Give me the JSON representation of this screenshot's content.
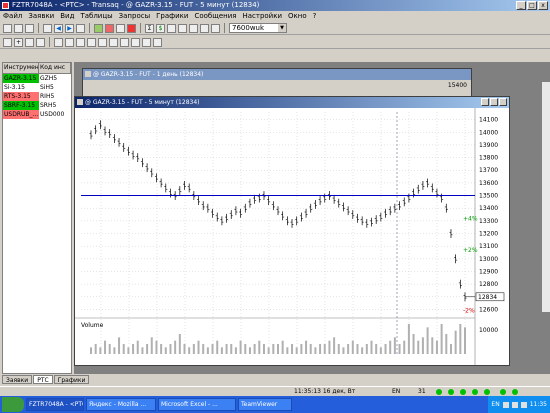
{
  "app": {
    "title": "FZTR7048A - <РТС> - Transaq - @ GAZR-3.15 - FUT - 5 минут (12834)",
    "minimize": "_",
    "maximize": "□",
    "close": "x"
  },
  "menu": [
    "Файл",
    "Заявки",
    "Вид",
    "Таблицы",
    "Запросы",
    "Графики",
    "Сообщения",
    "Настройки",
    "Окно",
    "?"
  ],
  "toolbar": {
    "combo_value": "7600wuk"
  },
  "left_panel": {
    "headers": [
      "Инструмент",
      "Код инс"
    ],
    "rows": [
      {
        "name": "GAZR-3.15",
        "code": "GZH5",
        "bg": "#00c000"
      },
      {
        "name": "Si-3.15",
        "code": "SiH5",
        "bg": "#ffffff"
      },
      {
        "name": "RTS-3.15",
        "code": "RIH5",
        "bg": "#ff7070"
      },
      {
        "name": "SBRF-3.15",
        "code": "SRH5",
        "bg": "#00c000"
      },
      {
        "name": "USDRUB_...",
        "code": "USD000",
        "bg": "#ff7070"
      }
    ]
  },
  "back_window": {
    "title": "@ GAZR-3.15 - FUT - 1 день (12834)",
    "price_label": "15400"
  },
  "front_window": {
    "title": "@ GAZR-3.15 - FUT - 5 минут (12834)",
    "volume_label": "Volume",
    "volume_axis": "10000"
  },
  "chart_data": {
    "type": "line",
    "y_axis_ticks": [
      14100,
      14000,
      13900,
      13800,
      13700,
      13600,
      13500,
      13400,
      13300,
      13200,
      13100,
      13000,
      12900,
      12800,
      12700,
      12600
    ],
    "ylim": [
      12580,
      14160
    ],
    "current_price": "12834",
    "level_line": 13500,
    "percent_labels": [
      {
        "text": "+4%",
        "y": 13320,
        "color": "#00a000"
      },
      {
        "text": "+2%",
        "y": 13070,
        "color": "#00a000"
      },
      {
        "text": "-2%",
        "y": 12590,
        "color": "#e00000"
      }
    ],
    "series": [
      {
        "values": [
          13980,
          14020,
          14060,
          14010,
          13990,
          13950,
          13920,
          13880,
          13850,
          13820,
          13800,
          13760,
          13720,
          13680,
          13640,
          13600,
          13560,
          13520,
          13500,
          13540,
          13580,
          13560,
          13500,
          13460,
          13420,
          13400,
          13360,
          13330,
          13300,
          13320,
          13350,
          13380,
          13360,
          13400,
          13440,
          13470,
          13480,
          13500,
          13460,
          13420,
          13380,
          13340,
          13300,
          13280,
          13300,
          13330,
          13360,
          13400,
          13430,
          13460,
          13480,
          13500,
          13470,
          13440,
          13410,
          13380,
          13350,
          13320,
          13300,
          13280,
          13290,
          13310,
          13330,
          13360,
          13380,
          13400,
          13420,
          13450,
          13480,
          13520,
          13550,
          13580,
          13600,
          13560,
          13520,
          13480,
          13400,
          13200,
          13000,
          12800,
          12700
        ]
      }
    ],
    "volume": [
      2,
      3,
      2,
      4,
      3,
      2,
      5,
      3,
      2,
      3,
      4,
      2,
      3,
      5,
      4,
      3,
      2,
      3,
      4,
      6,
      3,
      2,
      3,
      4,
      3,
      2,
      3,
      4,
      2,
      3,
      3,
      2,
      4,
      3,
      2,
      3,
      4,
      3,
      2,
      3,
      3,
      4,
      2,
      3,
      2,
      3,
      4,
      3,
      2,
      3,
      3,
      4,
      5,
      3,
      2,
      3,
      4,
      3,
      2,
      3,
      4,
      3,
      2,
      3,
      4,
      5,
      3,
      4,
      9,
      6,
      4,
      5,
      8,
      5,
      4,
      9,
      6,
      3,
      7,
      9,
      8
    ]
  },
  "tabs": [
    "Заявки",
    "РТС",
    "Графики"
  ],
  "status": {
    "time": "11:35:13 16 дек, Вт",
    "lang": "EN",
    "count": "31"
  },
  "taskbar": {
    "items": [
      "FZTR7048A - <РТС...",
      "Яндекс - Mozilla ...",
      "Microsoft Excel - ...",
      "TeamViewer"
    ],
    "tray_lang": "EN",
    "clock": "11:35"
  }
}
